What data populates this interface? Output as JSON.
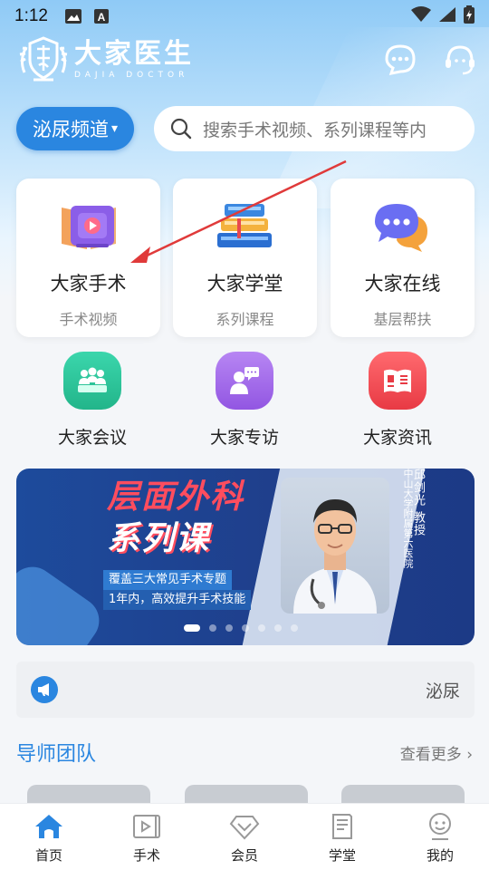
{
  "status_bar": {
    "time": "1:12"
  },
  "header": {
    "logo_cn": "大家医生",
    "logo_en": "DAJIA DOCTOR"
  },
  "channel": {
    "label": "泌尿频道",
    "caret": "▾"
  },
  "search": {
    "placeholder": "搜索手术视频、系列课程等内"
  },
  "cards": [
    {
      "title": "大家手术",
      "subtitle": "手术视频",
      "icon": "video-book-icon"
    },
    {
      "title": "大家学堂",
      "subtitle": "系列课程",
      "icon": "books-icon"
    },
    {
      "title": "大家在线",
      "subtitle": "基层帮扶",
      "icon": "chat-bubbles-icon"
    }
  ],
  "mini_items": [
    {
      "label": "大家会议",
      "icon": "meeting-icon",
      "color": "#2cc49a"
    },
    {
      "label": "大家专访",
      "icon": "interview-icon",
      "color": "#a66de8"
    },
    {
      "label": "大家资讯",
      "icon": "news-icon",
      "color": "#f0505a"
    }
  ],
  "banner": {
    "title_line1": "层面外科",
    "title_line2": "系列课",
    "tag1": "覆盖三大常见手术专题",
    "tag2": "1年内，高效提升手术技能",
    "doctor_name": "邱剑光 教授",
    "hospital": "中山大学附属第六医院",
    "slide_count": 7,
    "active_slide": 1
  },
  "notice": {
    "text": "泌尿",
    "icon": "megaphone-icon"
  },
  "section": {
    "title": "导师团队",
    "more": "查看更多 ›"
  },
  "tabbar": [
    {
      "label": "首页",
      "icon": "home-icon",
      "active": true
    },
    {
      "label": "手术",
      "icon": "video-icon",
      "active": false
    },
    {
      "label": "会员",
      "icon": "diamond-icon",
      "active": false
    },
    {
      "label": "学堂",
      "icon": "book-icon",
      "active": false
    },
    {
      "label": "我的",
      "icon": "profile-icon",
      "active": false
    }
  ],
  "colors": {
    "accent": "#2a86e0",
    "hero_top": "#8fcaf6",
    "banner_bg": "#1d4b9c",
    "annotation_arrow": "#e03a3a"
  }
}
